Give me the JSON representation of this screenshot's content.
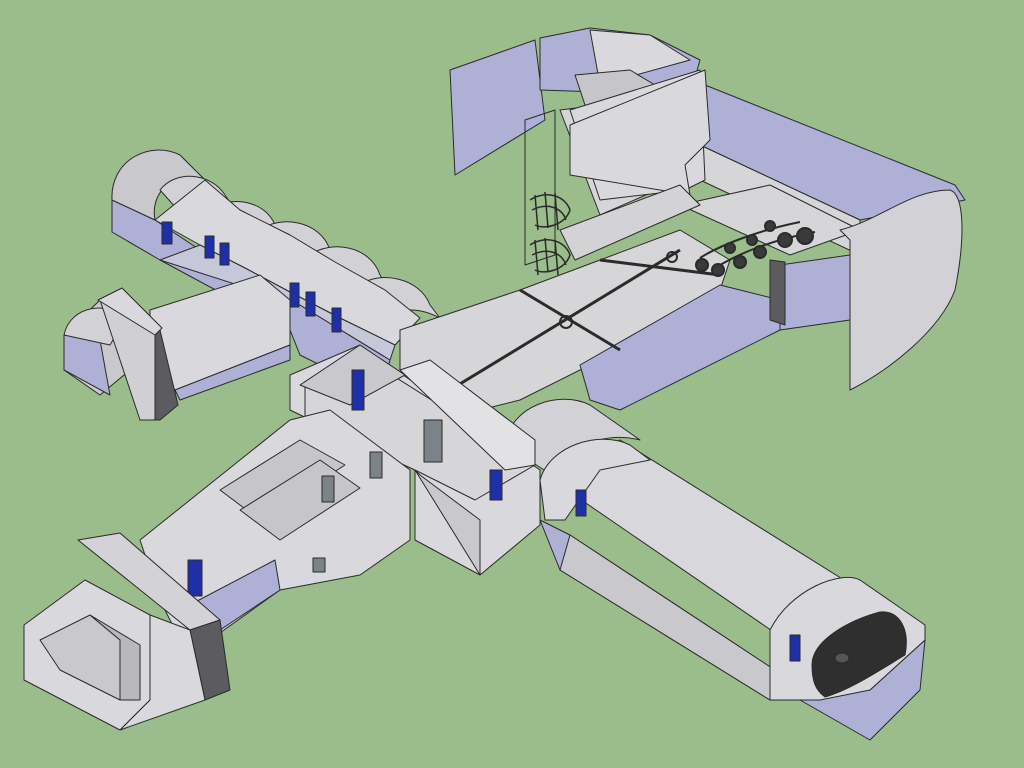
{
  "scene": {
    "kind": "3d-model-view",
    "subject": "bunker-floorplan-cutaway",
    "background_color": "#9abd8b",
    "colors": {
      "wall_light": "#d9d9dd",
      "wall_mid": "#c8c8cd",
      "wall_blue": "#aeb0d6",
      "wall_shadow": "#9c9ec8",
      "floor": "#d3d3d6",
      "door_blue": "#1f2fa8",
      "door_grey": "#7b8288",
      "machinery": "#3a3a3a",
      "tank": "#2f2f2f",
      "edge": "#2b2b2b"
    },
    "parts": [
      "northwest-vaulted-corridor",
      "west-entrance-block",
      "central-hall",
      "southwest-corridor",
      "southwest-entrance-block",
      "southeast-vaulted-corridor",
      "fuel-tank",
      "northeast-tower",
      "spiral-staircase",
      "engine-room",
      "engines"
    ]
  }
}
